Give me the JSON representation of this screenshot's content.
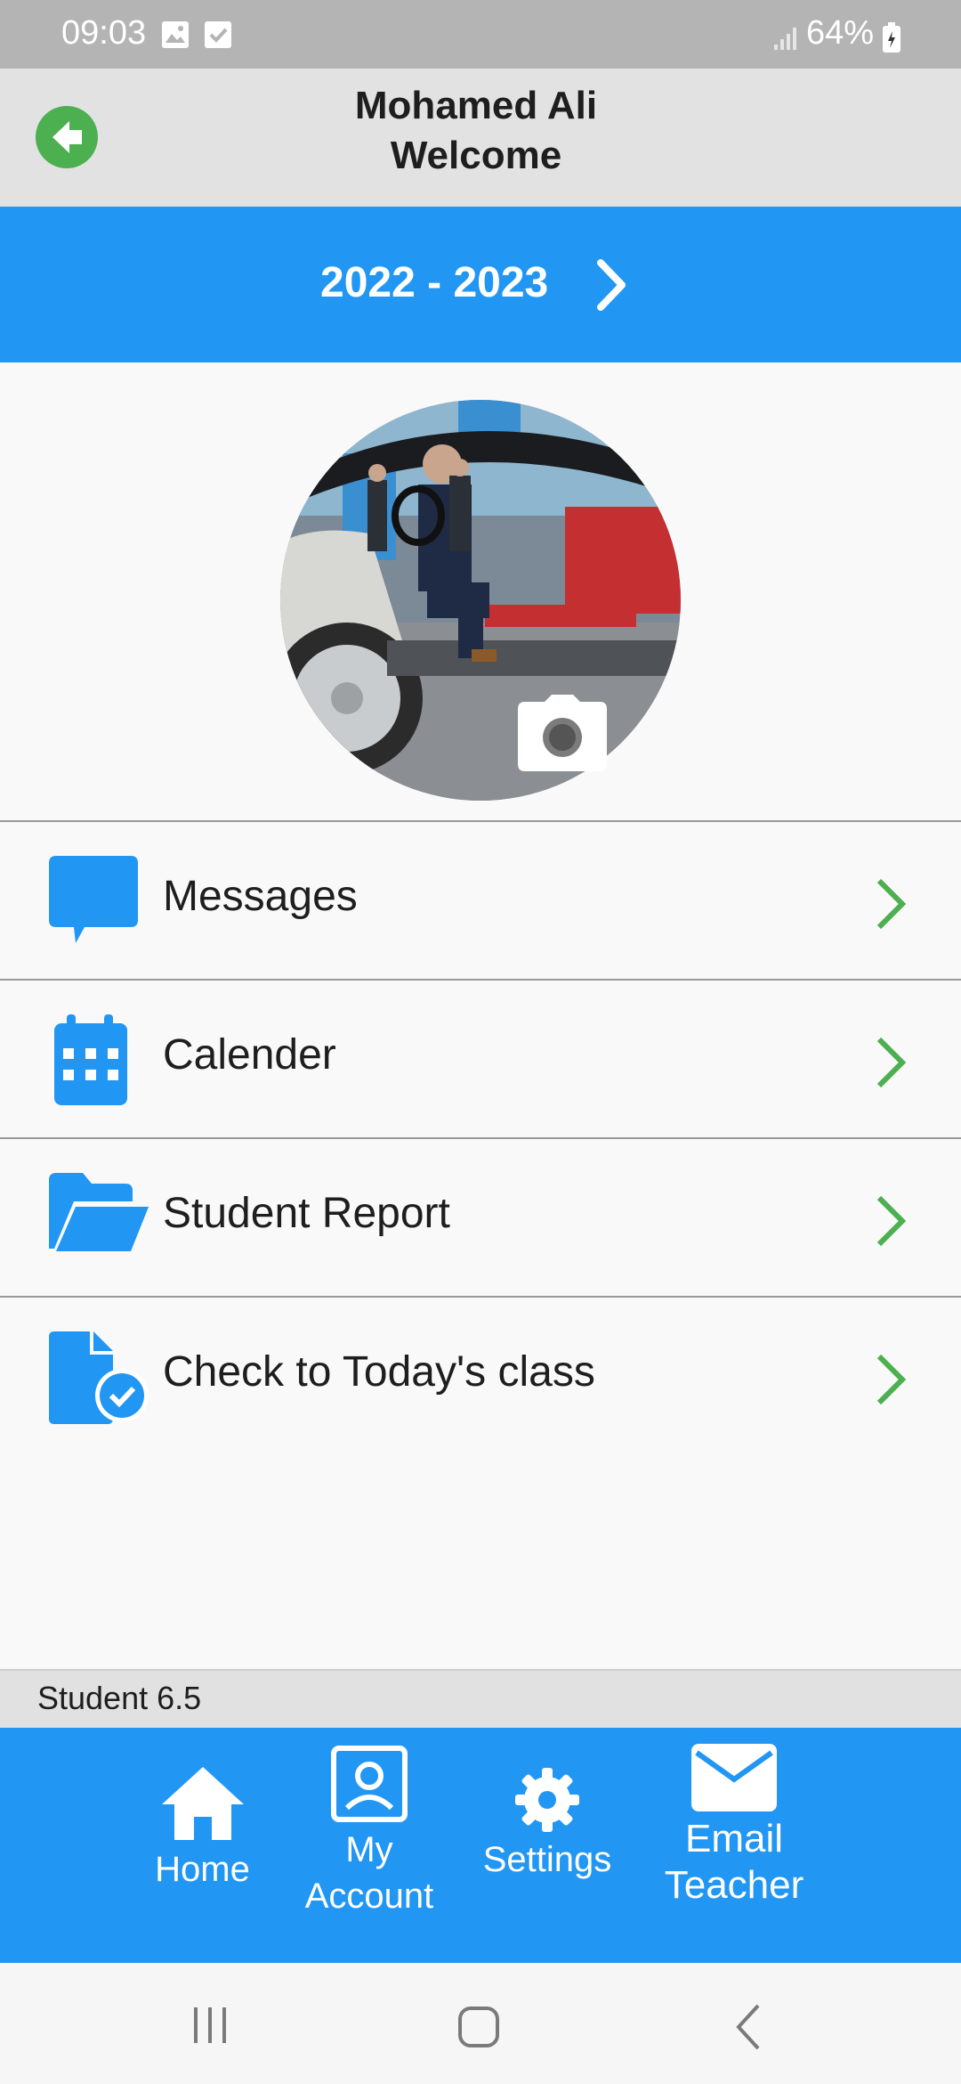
{
  "status_bar": {
    "time": "09:03",
    "battery": "64%",
    "icons": [
      "gallery-icon",
      "check-box-icon",
      "signal-icon",
      "battery-icon"
    ]
  },
  "header": {
    "name": "Mohamed Ali",
    "greeting": "Welcome",
    "back_icon": "arrow-left-circle-icon"
  },
  "year_selector": {
    "label": "2022 - 2023",
    "icon": "chevron-right-icon"
  },
  "profile": {
    "photo": "profile-photo",
    "camera_icon": "camera-icon"
  },
  "menu": {
    "items": [
      {
        "label": "Messages",
        "icon": "chat-bubble-icon"
      },
      {
        "label": "Calender",
        "icon": "calendar-icon"
      },
      {
        "label": "Student Report",
        "icon": "folder-open-icon"
      },
      {
        "label": "Check to Today's class",
        "icon": "document-check-icon"
      }
    ]
  },
  "footer": {
    "version": "Student 6.5"
  },
  "bottom_nav": {
    "items": [
      {
        "label": "Home",
        "icon": "home-icon"
      },
      {
        "label_line1": "My",
        "label_line2": "Account",
        "icon": "account-icon"
      },
      {
        "label": "Settings",
        "icon": "gear-icon"
      },
      {
        "label_line1": "Email",
        "label_line2": "Teacher",
        "icon": "envelope-icon"
      }
    ]
  },
  "colors": {
    "primary_blue": "#2196f3",
    "accent_green": "#4caf50",
    "header_gray": "#e2e2e2",
    "status_gray": "#b4b4b4"
  }
}
